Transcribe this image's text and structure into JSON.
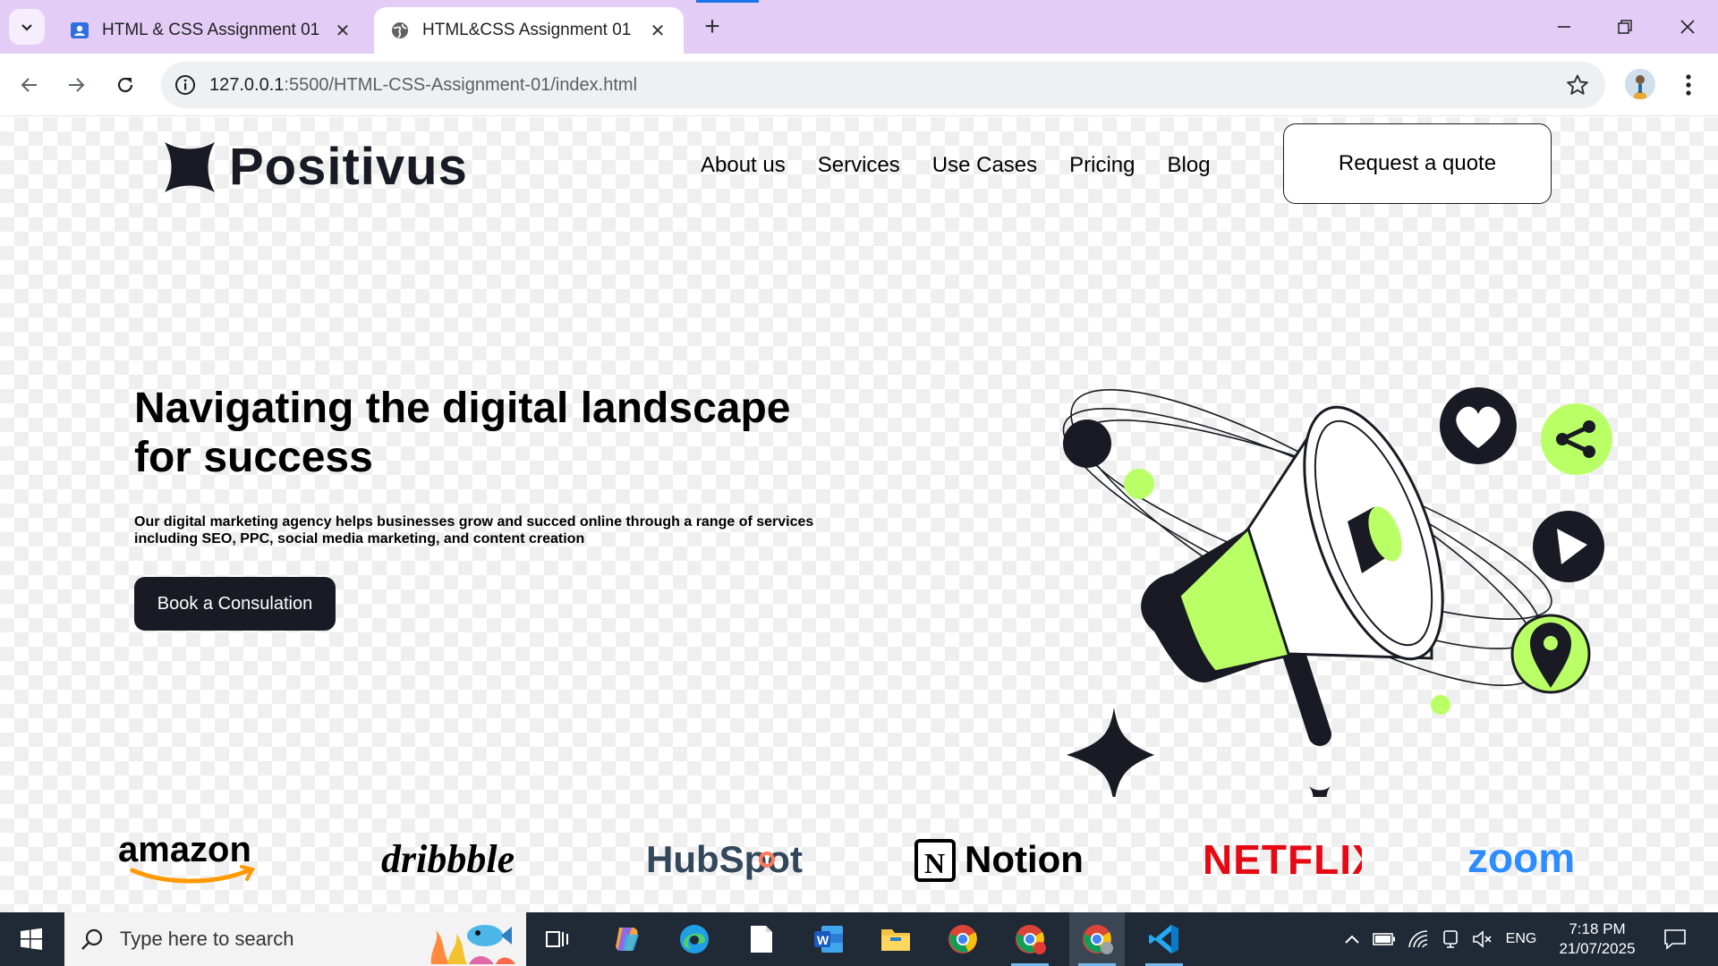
{
  "browser": {
    "tabs": [
      {
        "title": "HTML & CSS Assignment 01",
        "active": false
      },
      {
        "title": "HTML&CSS Assignment 01",
        "active": true
      }
    ],
    "url_host": "127.0.0.1",
    "url_rest": ":5500/HTML-CSS-Assignment-01/index.html"
  },
  "site": {
    "logo_text": "Positivus",
    "nav": [
      "About us",
      "Services",
      "Use Cases",
      "Pricing",
      "Blog"
    ],
    "quote_button": "Request a quote",
    "hero_title": "Navigating the digital landscape for success",
    "hero_description": "Our digital marketing agency helps businesses grow and succed online through a range of services including SEO, PPC, social media marketing, and content creation",
    "cta_button": "Book a Consulation",
    "brands": [
      "amazon",
      "dribbble",
      "HubSpot",
      "Notion",
      "NETFLIX",
      "zoom"
    ]
  },
  "taskbar": {
    "search_placeholder": "Type here to search",
    "language": "ENG",
    "time": "7:18 PM",
    "date": "21/07/2025"
  },
  "colors": {
    "accent": "#b9ff66",
    "dark": "#191a23",
    "tabbar": "#e3cdf7"
  }
}
